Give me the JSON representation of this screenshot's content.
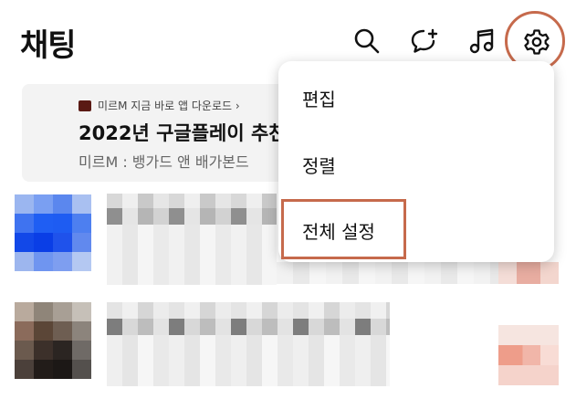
{
  "header": {
    "title": "채팅",
    "icons": [
      "search-icon",
      "new-chat-icon",
      "music-icon",
      "settings-gear-icon"
    ]
  },
  "ad": {
    "source": "미르M 지금 바로 앱 다운로드 ›",
    "headline": "2022년 구글플레이 추천",
    "subline": "미르M : 뱅가드 앤 배가본드"
  },
  "menu": {
    "items": [
      {
        "label": "편집"
      },
      {
        "label": "정렬"
      },
      {
        "label": "전체 설정"
      }
    ]
  },
  "colors": {
    "highlight": "#c66a4c",
    "banner_bg": "#f3f3f3"
  }
}
